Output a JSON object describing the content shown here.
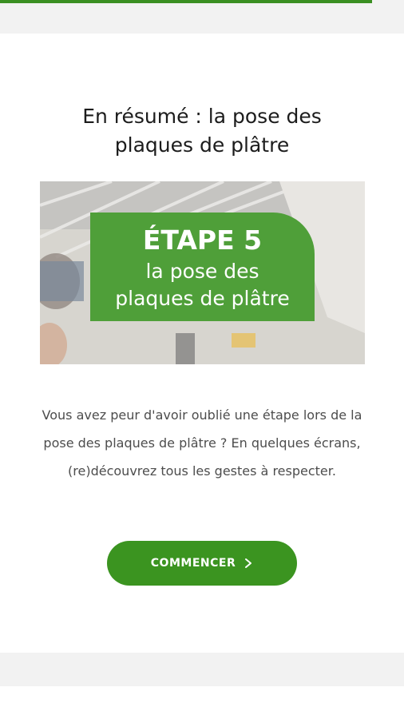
{
  "progress": {
    "fraction": 0.92,
    "color": "#3a8f22"
  },
  "content": {
    "title": "En résumé : la pose des\nplaques de plâtre",
    "hero": {
      "step_label": "ÉTAPE 5",
      "caption": "la pose des\nplaques de plâtre",
      "badge_color": "#4f9f39"
    },
    "description": "Vous avez peur d'avoir oublié une étape lors de la pose des plaques de plâtre ? En quelques écrans, (re)découvrez tous les gestes à respecter.",
    "cta": {
      "label": "COMMENCER",
      "icon": "chevron-right-icon",
      "color": "#3b9420"
    }
  }
}
